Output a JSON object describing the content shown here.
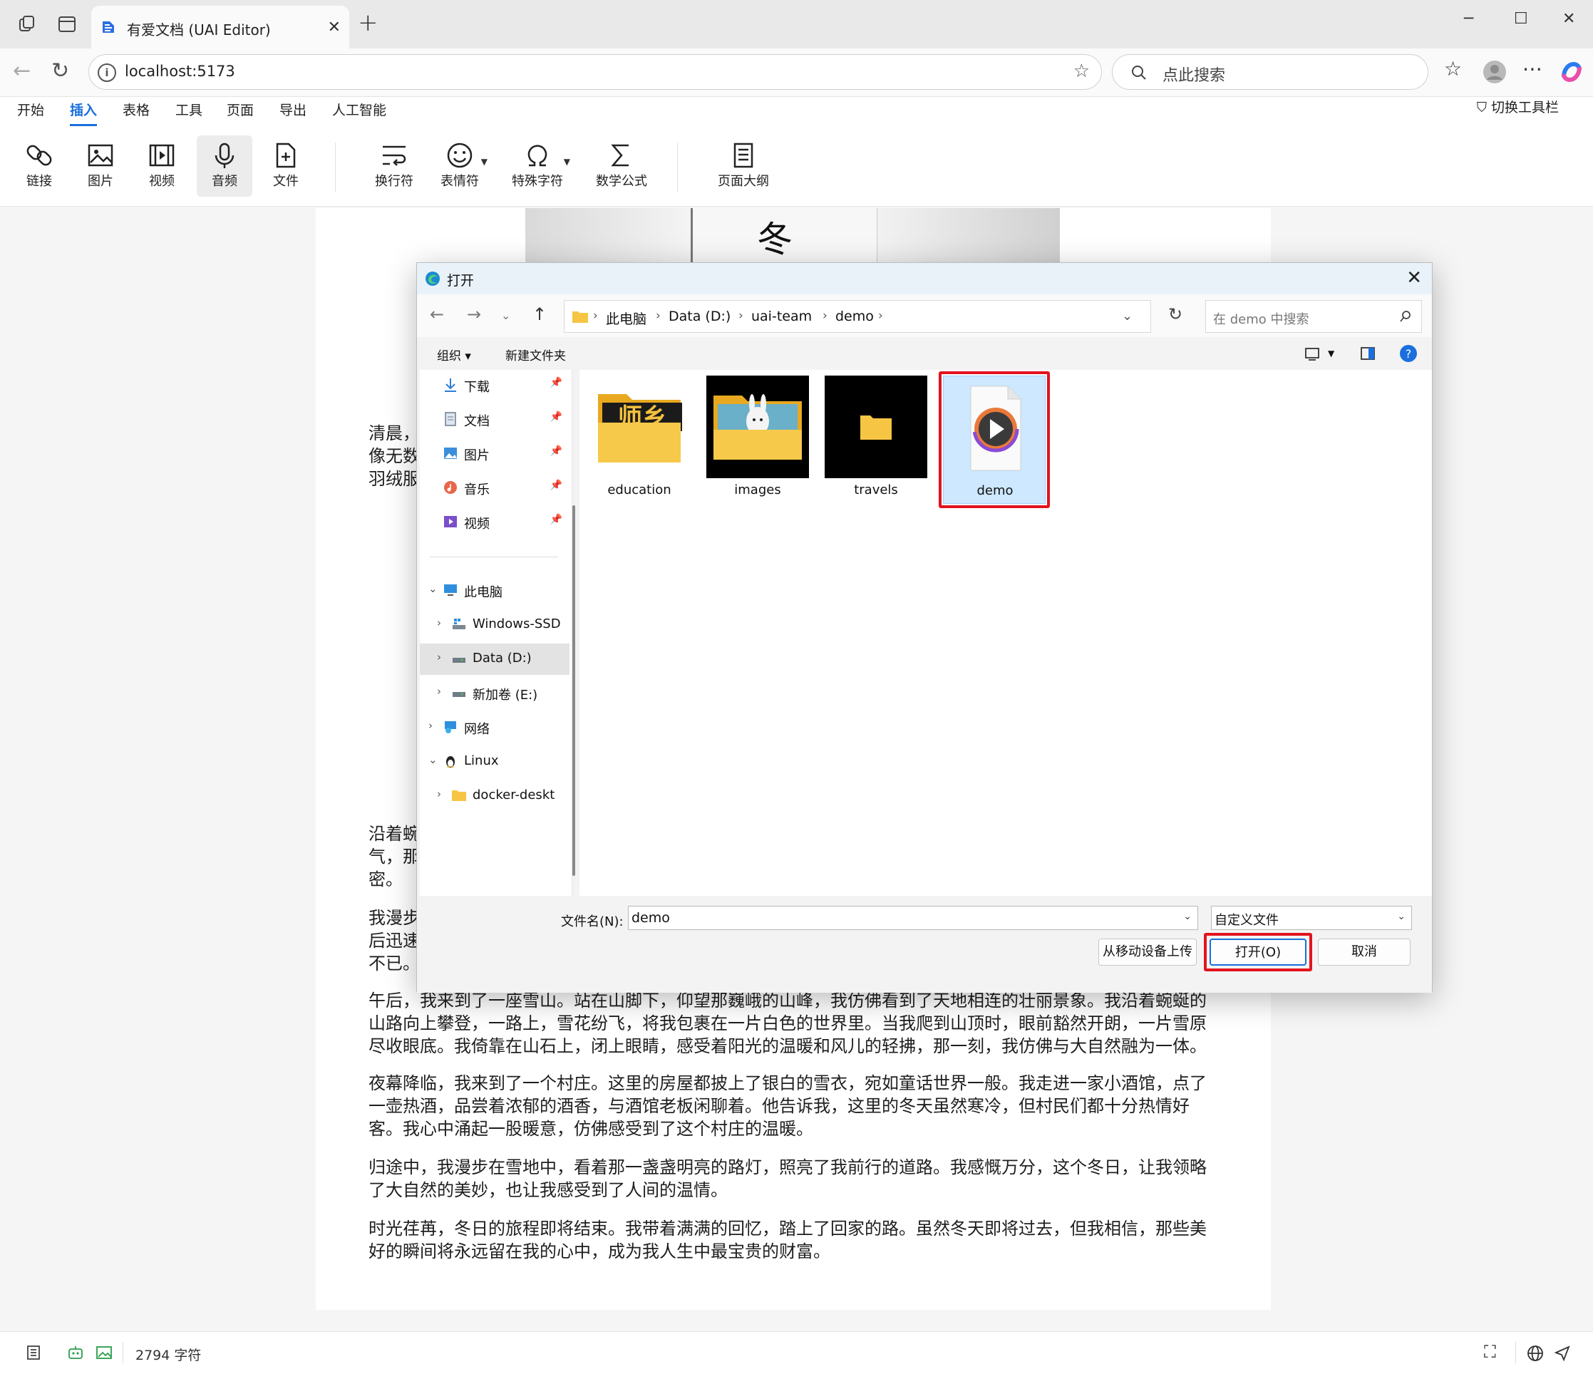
{
  "browser": {
    "tab_title": "有爱文档 (UAI Editor)",
    "tab_close": "✕",
    "new_tab": "+",
    "url": "localhost:5173",
    "search_placeholder": "点此搜索",
    "window_controls": [
      "─",
      "☐",
      "✕"
    ]
  },
  "app": {
    "menu_tabs": [
      "开始",
      "插入",
      "表格",
      "工具",
      "页面",
      "导出",
      "人工智能"
    ],
    "active_tab": "插入",
    "toggle_toolbar": "切换工具栏",
    "ribbon": {
      "link": "链接",
      "image": "图片",
      "video": "视频",
      "audio": "音频",
      "file": "文件",
      "line_break": "换行符",
      "emoji": "表情符",
      "special_char": "特殊字符",
      "math": "数学公式",
      "outline": "页面大纲"
    },
    "accent_color": "#1a6fdd"
  },
  "document": {
    "image_glyph": "冬",
    "p1": [
      "清晨，",
      "像无数",
      "羽绒服"
    ],
    "p2": [
      "沿着蜿",
      "气，那",
      "密。"
    ],
    "p3": [
      "我漫步",
      "后迅速",
      "不已。"
    ],
    "p4": [
      "午后，我来到了一座雪山。站在山脚下，仰望那巍峨的山峰，我仿佛看到了天地相连的壮丽景象。我沿着蜿蜒的",
      "山路向上攀登，一路上，雪花纷飞，将我包裹在一片白色的世界里。当我爬到山顶时，眼前豁然开朗，一片雪原",
      "尽收眼底。我倚靠在山石上，闭上眼睛，感受着阳光的温暖和风儿的轻拂，那一刻，我仿佛与大自然融为一体。"
    ],
    "p5": [
      "夜幕降临，我来到了一个村庄。这里的房屋都披上了银白的雪衣，宛如童话世界一般。我走进一家小酒馆，点了",
      "一壶热酒，品尝着浓郁的酒香，与酒馆老板闲聊着。他告诉我，这里的冬天虽然寒冷，但村民们都十分热情好",
      "客。我心中涌起一股暖意，仿佛感受到了这个村庄的温暖。"
    ],
    "p6": [
      "归途中，我漫步在雪地中，看着那一盏盏明亮的路灯，照亮了我前行的道路。我感慨万分，这个冬日，让我领略",
      "了大自然的美妙，也让我感受到了人间的温情。"
    ],
    "p7": [
      "时光荏苒，冬日的旅程即将结束。我带着满满的回忆，踏上了回家的路。虽然冬天即将过去，但我相信，那些美",
      "好的瞬间将永远留在我的心中，成为我人生中最宝贵的财富。"
    ]
  },
  "statusbar": {
    "char_count": "2794 字符"
  },
  "dialog": {
    "title": "打开",
    "close": "✕",
    "breadcrumb": [
      "此电脑",
      "Data (D:)",
      "uai-team",
      "demo"
    ],
    "search_placeholder": "在 demo 中搜索",
    "organize": "组织 ▾",
    "new_folder": "新建文件夹",
    "quick_access": [
      {
        "label": "下载",
        "icon": "download-icon"
      },
      {
        "label": "文档",
        "icon": "document-icon"
      },
      {
        "label": "图片",
        "icon": "pictures-icon"
      },
      {
        "label": "音乐",
        "icon": "music-icon"
      },
      {
        "label": "视频",
        "icon": "videos-icon"
      }
    ],
    "tree": {
      "this_pc": "此电脑",
      "windows_ssd": "Windows-SSD",
      "data_d": "Data (D:)",
      "new_volume_e": "新加卷 (E:)",
      "network": "网络",
      "linux": "Linux",
      "docker": "docker-deskt"
    },
    "files": [
      {
        "name": "education",
        "type": "folder"
      },
      {
        "name": "images",
        "type": "folder"
      },
      {
        "name": "travels",
        "type": "folder"
      },
      {
        "name": "demo",
        "type": "video-file",
        "selected": true
      }
    ],
    "folder_art_text": "师乡",
    "filename_label": "文件名(N):",
    "filename_value": "demo",
    "filetype_value": "自定义文件",
    "upload_mobile": "从移动设备上传",
    "open_button": "打开(O)",
    "cancel_button": "取消",
    "highlight_color": "#e2131e"
  }
}
